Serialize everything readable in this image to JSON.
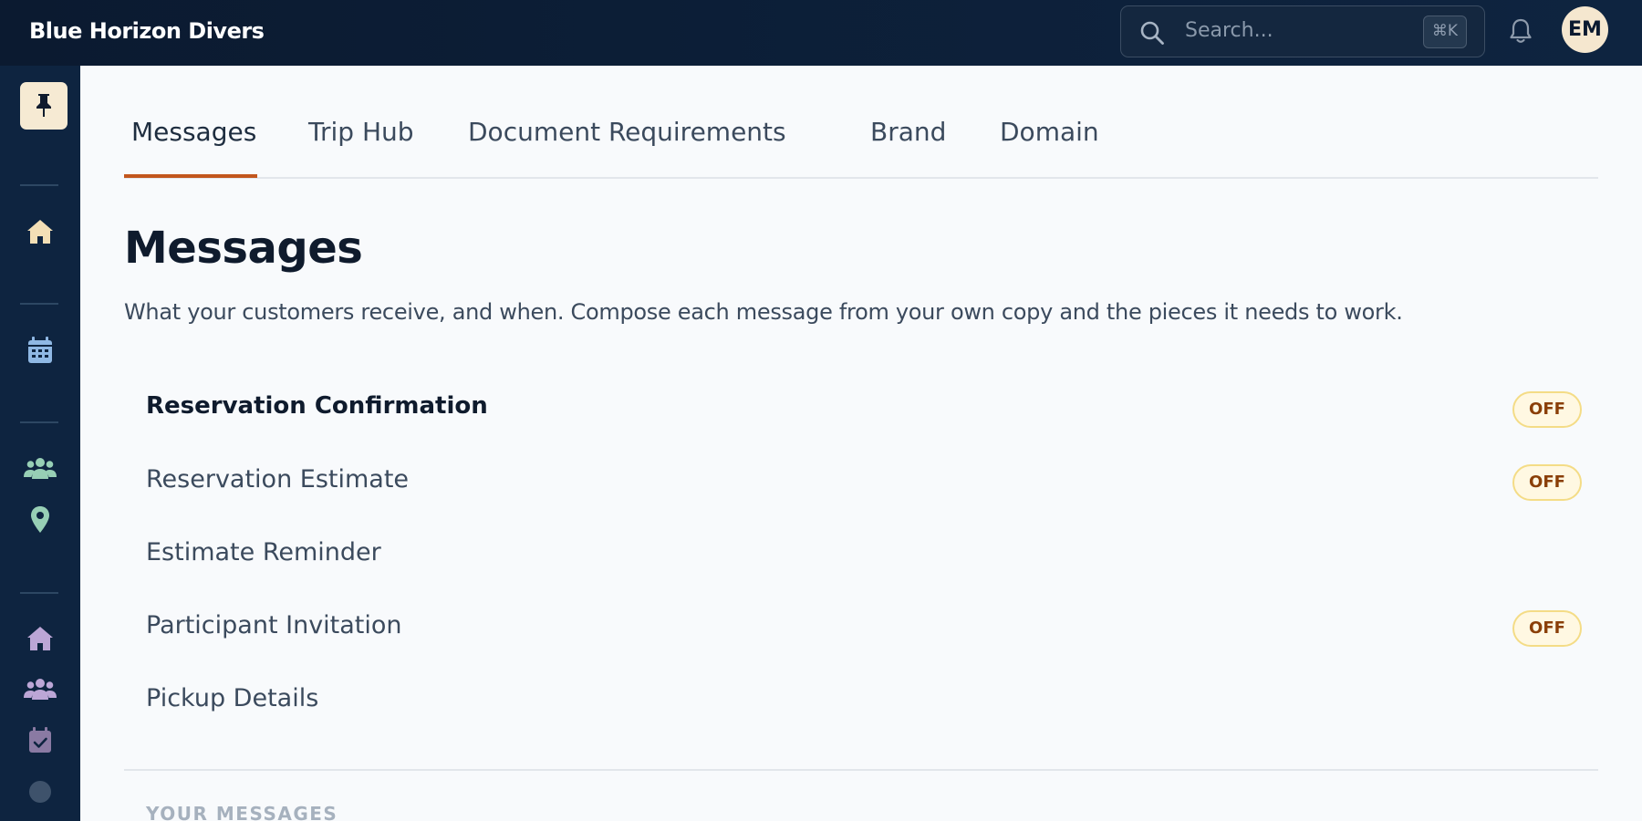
{
  "app": {
    "brand": "Blue Horizon Divers"
  },
  "topbar": {
    "search_placeholder": "Search...",
    "shortcut": "⌘K",
    "avatar_initials": "EM"
  },
  "colors": {
    "accent": "#c2561d",
    "topbar_bg": "#0b1a30",
    "badge_off_bg": "#fff8e2",
    "badge_off_text": "#8a3f08"
  },
  "sidebar": {
    "icons": [
      "pin-icon",
      "home-icon",
      "calendar-icon",
      "people-icon",
      "location-pin-icon",
      "home-icon",
      "people-icon",
      "calendar-check-icon"
    ]
  },
  "tabs": [
    {
      "label": "Messages",
      "active": true
    },
    {
      "label": "Trip Hub",
      "active": false
    },
    {
      "label": "Document Requirements",
      "active": false
    },
    {
      "label": "Brand",
      "active": false
    },
    {
      "label": "Domain",
      "active": false
    }
  ],
  "page": {
    "title": "Messages",
    "description": "What your customers receive, and when. Compose each message from your own copy and the pieces it needs to work."
  },
  "messages": [
    {
      "label": "Reservation Confirmation",
      "status": "OFF",
      "selected": true
    },
    {
      "label": "Reservation Estimate",
      "status": "OFF",
      "selected": false
    },
    {
      "label": "Estimate Reminder",
      "status": "",
      "selected": false
    },
    {
      "label": "Participant Invitation",
      "status": "OFF",
      "selected": false
    },
    {
      "label": "Pickup Details",
      "status": "",
      "selected": false
    }
  ],
  "your_messages": {
    "section_label": "YOUR MESSAGES"
  }
}
